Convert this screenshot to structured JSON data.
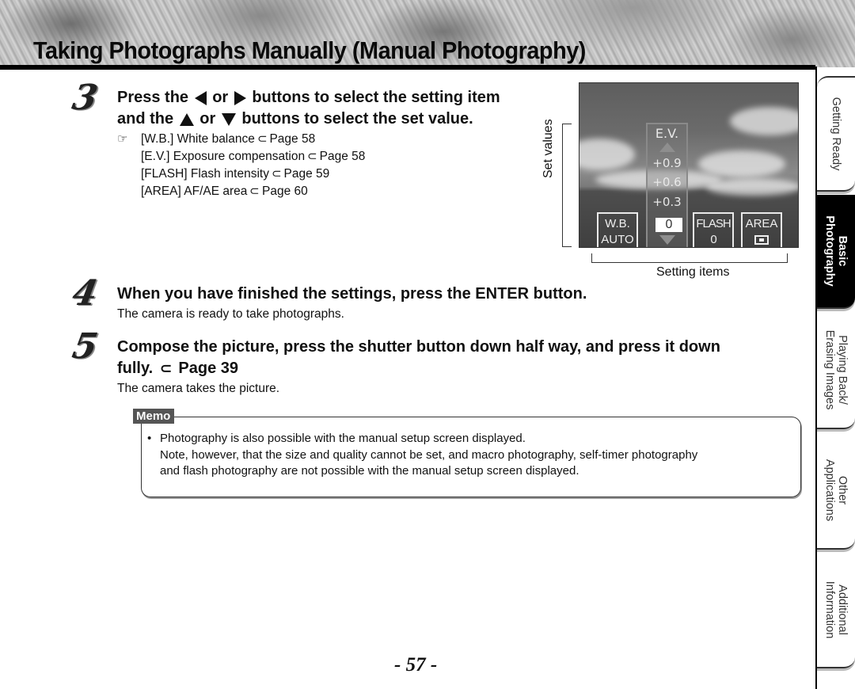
{
  "header": {
    "title": "Taking Photographs Manually (Manual Photography)"
  },
  "steps": [
    {
      "number": "3",
      "title_line1": [
        "Press the",
        "or",
        "buttons to select the setting item"
      ],
      "title_line1_icons": [
        "left-triangle",
        "right-triangle"
      ],
      "title_line2": [
        "and the",
        "or",
        "buttons to select the set value."
      ],
      "title_line2_icons": [
        "up-triangle",
        "down-triangle"
      ],
      "references": [
        {
          "text": "[W.B.] White balance",
          "page": "Page 58"
        },
        {
          "text": "[E.V.] Exposure compensation",
          "page": "Page 58"
        },
        {
          "text": "[FLASH] Flash intensity",
          "page": "Page 59"
        },
        {
          "text": "[AREA] AF/AE area",
          "page": "Page 60"
        }
      ]
    },
    {
      "number": "4",
      "title": "When you have finished the settings, press the ENTER button.",
      "body": "The camera is ready to take photographs."
    },
    {
      "number": "5",
      "title_line1": "Compose the picture, press the shutter button down half way, and press it down",
      "title_line2_prefix": "fully.",
      "title_line2_page": "Page 39",
      "body": "The camera takes the picture."
    }
  ],
  "screen": {
    "ev_label": "E.V.",
    "ev_values": [
      "+0.9",
      "+0.6",
      "+0.3"
    ],
    "ev_selected": "0",
    "wb_label": "W.B.",
    "wb_value": "AUTO",
    "flash_label": "FLASH",
    "flash_value": "0",
    "area_label": "AREA",
    "area_icon": "area-frame-icon"
  },
  "callouts": {
    "set_values": "Set values",
    "setting_items": "Setting items"
  },
  "memo": {
    "tag": "Memo",
    "bullet": "•",
    "line1": "Photography is also possible with the manual setup screen displayed.",
    "line2": "Note, however, that the size and quality cannot be set, and macro photography, self-timer photography",
    "line3": "and flash photography are not possible with the manual setup screen displayed."
  },
  "page_number": "- 57 -",
  "side_tabs": [
    {
      "line1": "Getting Ready",
      "line2": "",
      "active": false
    },
    {
      "line1": "Basic",
      "line2": "Photography",
      "active": true
    },
    {
      "line1": "Playing Back/",
      "line2": "Erasing Images",
      "active": false
    },
    {
      "line1": "Other",
      "line2": "Applications",
      "active": false
    },
    {
      "line1": "Additional",
      "line2": "Information",
      "active": false
    }
  ],
  "icons": {
    "reference_hand": "☞",
    "page_ref_arrow": "⊃"
  }
}
